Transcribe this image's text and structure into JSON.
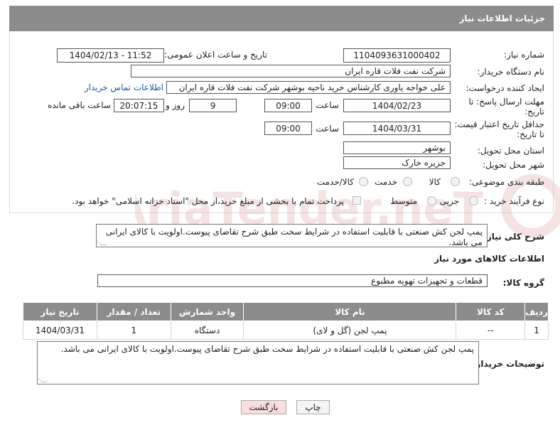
{
  "header": {
    "title": "جزئیات اطلاعات نیاز"
  },
  "form": {
    "need_number": {
      "label": "شماره نیاز:",
      "value": "1104093631000402"
    },
    "announce": {
      "label": "تاریخ و ساعت اعلان عمومی:",
      "value": "1404/02/13 - 11:52"
    },
    "buyer_org": {
      "label": "نام دستگاه خریدار:",
      "value": "شرکت نفت فلات قاره ایران"
    },
    "creator": {
      "label": "ایجاد کننده درخواست:",
      "value": "علی خواجه یاوری کارشناس خرید ناحیه بوشهر  شرکت نفت فلات قاره ایران",
      "contact_link": "اطلاعات تماس خریدار"
    },
    "reply_deadline": {
      "label_line1": "مهلت ارسال پاسخ: تا",
      "label_line2": "تاریخ:",
      "date": "1404/02/23",
      "time_label": "ساعت",
      "time": "09:00",
      "days": "9",
      "days_label": "روز و",
      "remaining": "20:07:15",
      "remaining_label": "ساعت باقی مانده"
    },
    "price_validity": {
      "label_line1": "حداقل تاریخ اعتبار قیمت:",
      "label_line2": "تا تاریخ:",
      "date": "1404/03/31",
      "time_label": "ساعت",
      "time": "09:00"
    },
    "province": {
      "label": "استان محل تحویل:",
      "value": "بوشهر"
    },
    "city": {
      "label": "شهر محل تحویل:",
      "value": "جزیره خارک"
    },
    "category": {
      "label": "طبقه بندی موضوعی:",
      "options": [
        "کالا",
        "خدمت",
        "کالا/خدمت"
      ]
    },
    "process": {
      "label": "نوع فرآیند خرید :",
      "options": [
        "جزیی",
        "متوسط"
      ],
      "note": "پرداخت تمام یا بخشی از مبلغ خرید،از محل \"اسناد خزانه اسلامی\" خواهد بود."
    }
  },
  "description": {
    "label": "شرح کلی نیاز:",
    "text": "پمپ لجن کش صنعتی با قابلیت استفاده در شرایط سخت طبق شرح تقاضای پیوست.اولویت با کالای ایرانی می باشد."
  },
  "goods_section": {
    "title": "اطلاعات کالاهای مورد نیاز",
    "group_label": "گروه کالا:",
    "group_value": "قطعات و تجهیزات تهویه مطبوع"
  },
  "table": {
    "headers": [
      "ردیف",
      "کد کالا",
      "نام کالا",
      "واحد شمارش",
      "تعداد / مقدار",
      "تاریخ نیاز"
    ],
    "rows": [
      [
        "1",
        "--",
        "پمپ لجن (گل و لای)",
        "دستگاه",
        "1",
        "1404/03/31"
      ]
    ]
  },
  "buyer_notes": {
    "label": "توضیحات خریدار:",
    "text": "پمپ لجن کش صنعتی با قابلیت استفاده در شرایط سخت طبق شرح تقاضای پیوست.اولویت با کالای ایرانی می باشد."
  },
  "buttons": {
    "print": "چاپ",
    "back": "بازگشت"
  },
  "watermark": {
    "text": "AriaTender.neT"
  },
  "colors": {
    "header_bg": "#8c8c8c",
    "link": "#1a5aa6",
    "back_bg": "#f9dede",
    "watermark": "#e3b0b0"
  }
}
